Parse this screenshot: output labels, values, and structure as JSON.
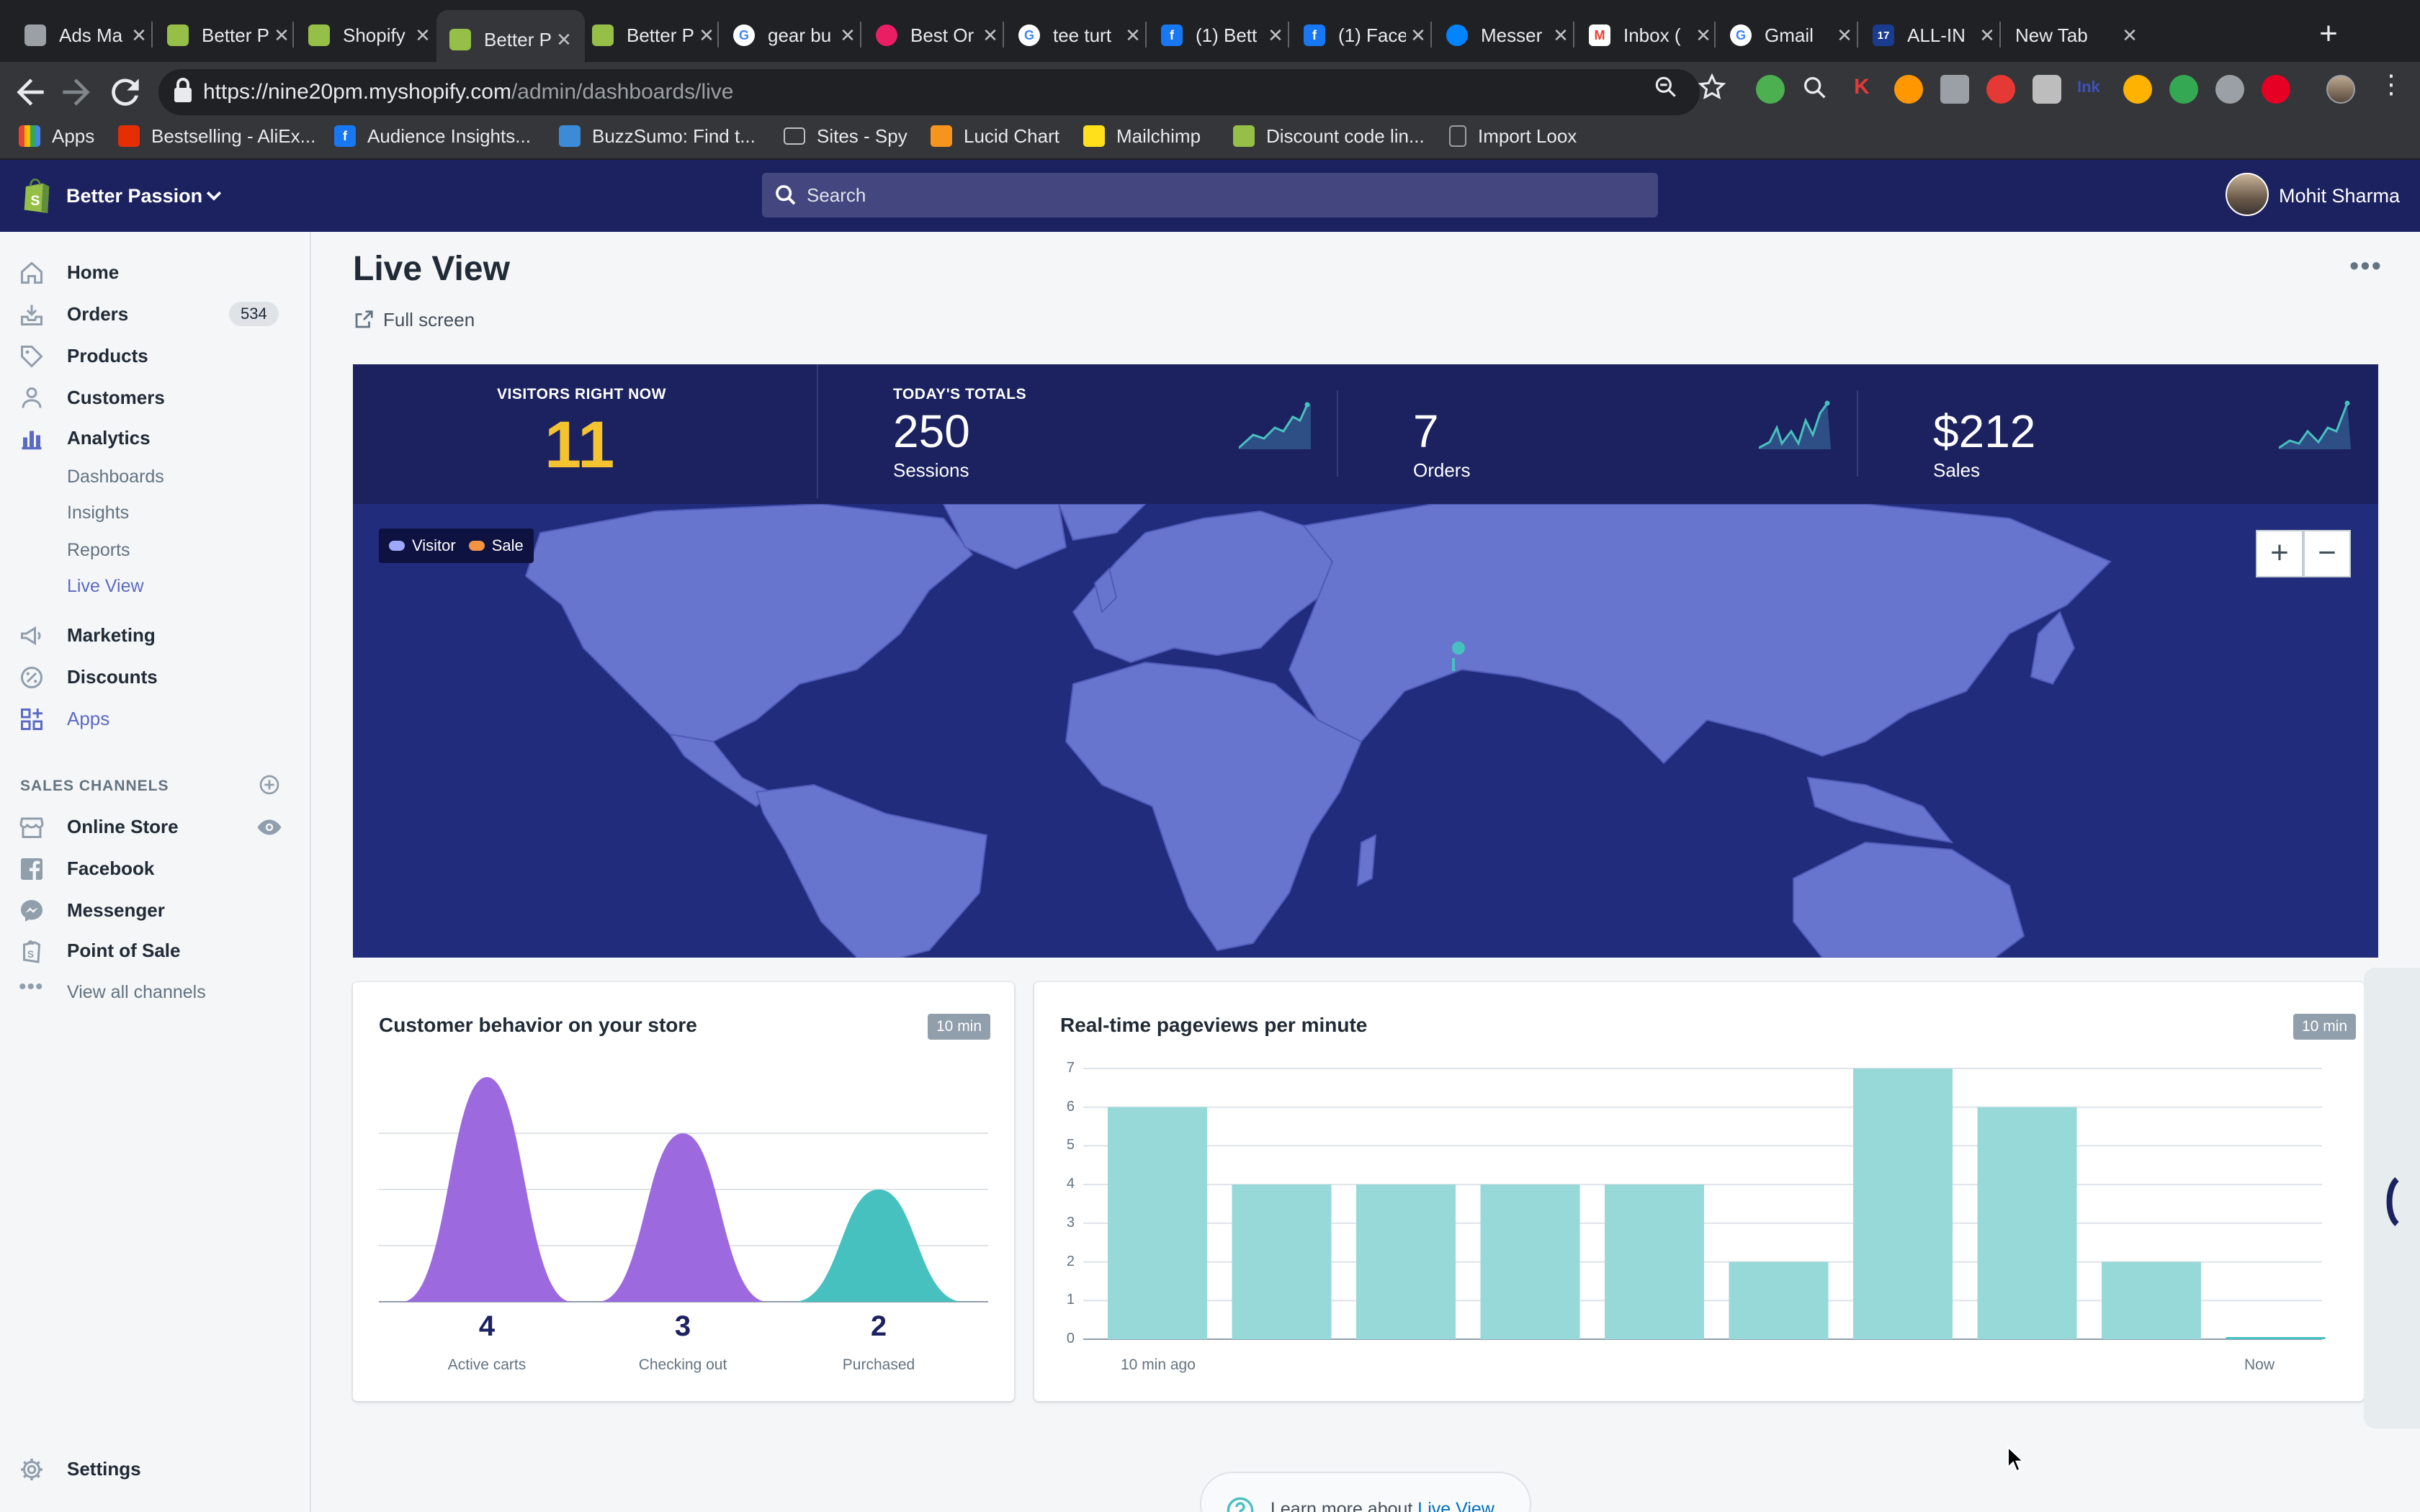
{
  "browser": {
    "tabs": [
      {
        "title": "Ads Ma",
        "icon": "ads-manager-icon",
        "color": "#9aa0a6"
      },
      {
        "title": "Better P",
        "icon": "shopify-icon",
        "color": "#95bf47"
      },
      {
        "title": "Shopify",
        "icon": "shopify-icon",
        "color": "#95bf47"
      },
      {
        "title": "Better P",
        "icon": "shopify-icon",
        "color": "#95bf47",
        "active": true
      },
      {
        "title": "Better P",
        "icon": "shopify-icon",
        "color": "#95bf47"
      },
      {
        "title": "gear bu",
        "icon": "google-icon",
        "color": "#ffffff"
      },
      {
        "title": "Best Or",
        "icon": "pink-ball-icon",
        "color": "#e91e63"
      },
      {
        "title": "tee turt",
        "icon": "google-icon",
        "color": "#ffffff"
      },
      {
        "title": "(1) Bett",
        "icon": "facebook-icon",
        "color": "#1877f2"
      },
      {
        "title": "(1) Face",
        "icon": "facebook-icon",
        "color": "#1877f2"
      },
      {
        "title": "Messer",
        "icon": "messenger-icon",
        "color": "#0084ff"
      },
      {
        "title": "Inbox (",
        "icon": "gmail-icon",
        "color": "#ea4335"
      },
      {
        "title": "Gmail",
        "icon": "google-icon",
        "color": "#ffffff"
      },
      {
        "title": "ALL-IN",
        "icon": "seventeen-icon",
        "color": "#1a3c8f"
      },
      {
        "title": "New Tab",
        "icon": "",
        "color": ""
      }
    ],
    "url_host": "https://nine20pm.myshopify.com",
    "url_path": "/admin/dashboards/live",
    "bookmarks": [
      {
        "label": "Apps",
        "icon": "apps-grid-icon",
        "color": "#4285f4"
      },
      {
        "label": "Bestselling - AliEx...",
        "icon": "aliexpress-icon",
        "color": "#e62e04"
      },
      {
        "label": "Audience Insights...",
        "icon": "facebook-icon",
        "color": "#1877f2"
      },
      {
        "label": "BuzzSumo: Find t...",
        "icon": "buzzsumo-icon",
        "color": "#3b8bd6"
      },
      {
        "label": "Sites - Spy",
        "icon": "folder-icon",
        "color": "#9aa0a6"
      },
      {
        "label": "Lucid Chart",
        "icon": "lucidchart-icon",
        "color": "#f7941d"
      },
      {
        "label": "Mailchimp",
        "icon": "mailchimp-icon",
        "color": "#ffe01b"
      },
      {
        "label": "Discount code lin...",
        "icon": "shopify-icon",
        "color": "#95bf47"
      },
      {
        "label": "Import Loox",
        "icon": "page-icon",
        "color": "#9aa0a6"
      }
    ]
  },
  "topbar": {
    "store_name": "Better Passion",
    "search_placeholder": "Search",
    "user_name": "Mohit Sharma"
  },
  "sidebar": {
    "items": [
      {
        "label": "Home",
        "icon": "home-icon"
      },
      {
        "label": "Orders",
        "icon": "orders-icon",
        "badge": "534"
      },
      {
        "label": "Products",
        "icon": "tag-icon"
      },
      {
        "label": "Customers",
        "icon": "person-icon"
      },
      {
        "label": "Analytics",
        "icon": "bar-chart-icon"
      }
    ],
    "analytics_sub": [
      "Dashboards",
      "Insights",
      "Reports",
      "Live View"
    ],
    "items2": [
      {
        "label": "Marketing",
        "icon": "megaphone-icon"
      },
      {
        "label": "Discounts",
        "icon": "discount-icon"
      },
      {
        "label": "Apps",
        "icon": "apps-icon"
      }
    ],
    "sales_channels_header": "SALES CHANNELS",
    "channels": [
      {
        "label": "Online Store",
        "icon": "store-icon"
      },
      {
        "label": "Facebook",
        "icon": "facebook-icon"
      },
      {
        "label": "Messenger",
        "icon": "messenger-icon"
      },
      {
        "label": "Point of Sale",
        "icon": "pos-icon"
      }
    ],
    "view_all": "View all channels",
    "settings": "Settings"
  },
  "main": {
    "title": "Live View",
    "fullscreen": "Full screen",
    "stats": {
      "visitors_caption": "VISITORS RIGHT NOW",
      "visitors": "11",
      "totals_caption": "TODAY'S TOTALS",
      "sessions": "250",
      "sessions_label": "Sessions",
      "orders": "7",
      "orders_label": "Orders",
      "sales": "$212",
      "sales_label": "Sales"
    },
    "map": {
      "legend_visitor": "Visitor",
      "legend_sale": "Sale",
      "zoom_in": "+",
      "zoom_out": "−",
      "visitor_color": "#9ea8ff",
      "sale_color": "#f49342",
      "marker_color": "#47c1bf"
    },
    "behavior_card": {
      "title": "Customer behavior on your store",
      "pill": "10 min",
      "stages": [
        {
          "value": "4",
          "label": "Active carts",
          "color": "#9c6ade"
        },
        {
          "value": "3",
          "label": "Checking out",
          "color": "#9c6ade"
        },
        {
          "value": "2",
          "label": "Purchased",
          "color": "#47c1bf"
        }
      ]
    },
    "pageviews_card": {
      "title": "Real-time pageviews per minute",
      "pill": "10 min",
      "x_start": "10 min ago",
      "x_end": "Now"
    },
    "learn_more_text": "Learn more about ",
    "learn_more_link": "Live View"
  },
  "chart_data": [
    {
      "type": "bar",
      "title": "Real-time pageviews per minute",
      "categories": [
        "10 min ago",
        "",
        "",
        "",
        "",
        "",
        "",
        "",
        "",
        "Now"
      ],
      "values": [
        6,
        4,
        4,
        4,
        4,
        2,
        7,
        6,
        2,
        0
      ],
      "ylim": [
        0,
        7
      ],
      "yticks": [
        0,
        1,
        2,
        3,
        4,
        5,
        6,
        7
      ],
      "grid": true,
      "color": "#96d9d8"
    },
    {
      "type": "area",
      "title": "Customer behavior on your store",
      "categories": [
        "Active carts",
        "Checking out",
        "Purchased"
      ],
      "values": [
        4,
        3,
        2
      ],
      "grid": true
    }
  ]
}
